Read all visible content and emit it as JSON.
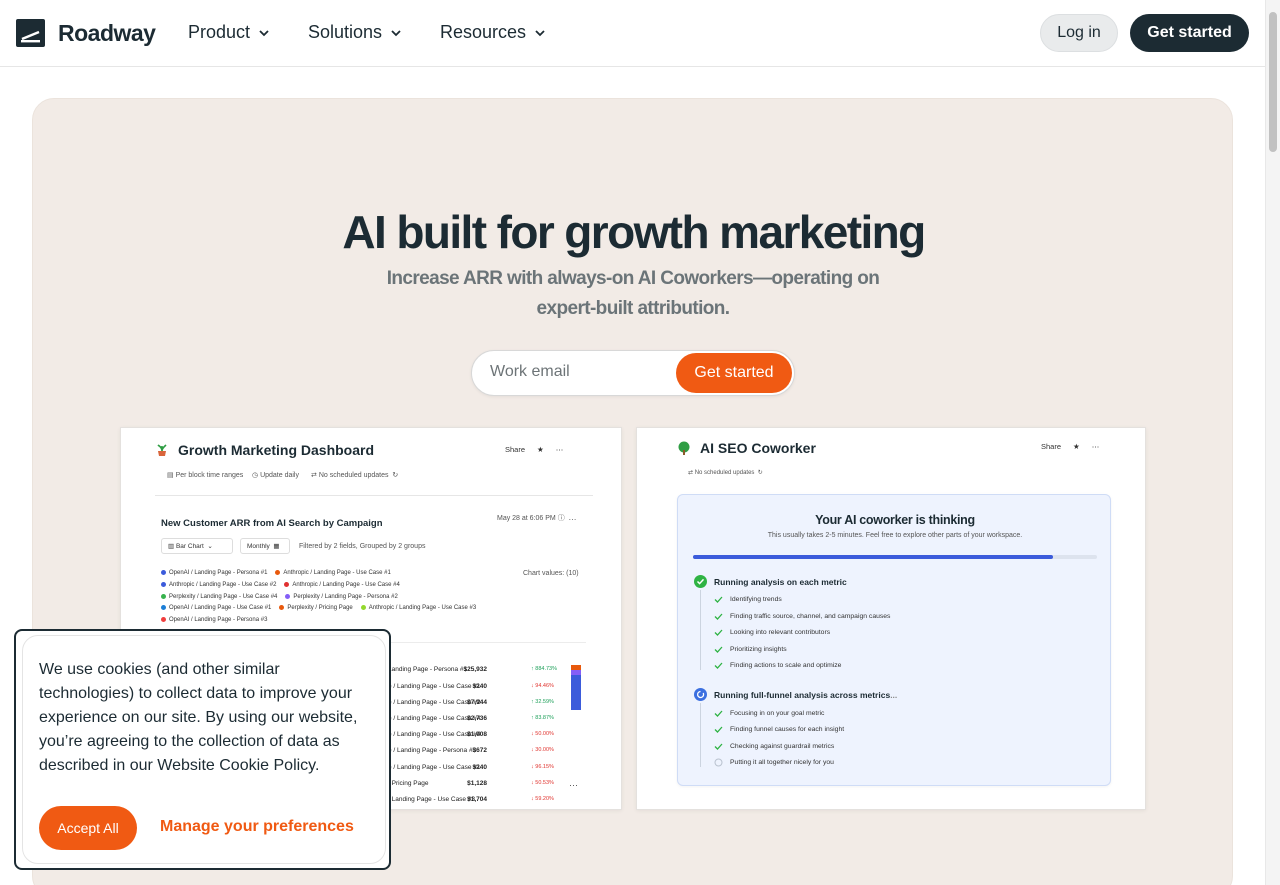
{
  "brand": {
    "name": "Roadway"
  },
  "nav": {
    "items": [
      {
        "label": "Product"
      },
      {
        "label": "Solutions"
      },
      {
        "label": "Resources"
      }
    ],
    "login": "Log in",
    "get_started": "Get started"
  },
  "hero": {
    "title": "AI built for growth marketing",
    "subtitle": "Increase ARR with always-on AI Coworkers—operating on expert-built attribution.",
    "email_placeholder": "Work email",
    "cta": "Get started"
  },
  "dashboard": {
    "title": "Growth Marketing Dashboard",
    "share": "Share",
    "meta": [
      "Per block time ranges",
      "Update daily",
      "No scheduled updates"
    ],
    "chart_title": "New Customer ARR from AI Search by Campaign",
    "chart_date": "May 28 at 6:06 PM",
    "chart_type": "Bar Chart",
    "period": "Monthly",
    "filter": "Filtered by 2 fields, Grouped by 2 groups",
    "chart_values": "Chart values: (10)",
    "legend": [
      {
        "label": "OpenAI / Landing Page - Persona #1",
        "color": "#3b5bdb"
      },
      {
        "label": "Anthropic / Landing Page - Use Case #1",
        "color": "#e8590c"
      },
      {
        "label": "Anthropic / Landing Page - Use Case #2",
        "color": "#3b5bdb"
      },
      {
        "label": "Anthropic / Landing Page - Use Case #4",
        "color": "#e03131"
      },
      {
        "label": "Perplexity / Landing Page - Use Case #4",
        "color": "#37b24d"
      },
      {
        "label": "Perplexity / Landing Page - Persona #2",
        "color": "#845ef7"
      },
      {
        "label": "OpenAI / Landing Page - Use Case #1",
        "color": "#1c7ed6"
      },
      {
        "label": "Perplexity / Pricing Page",
        "color": "#e8590c"
      },
      {
        "label": "Anthropic / Landing Page - Use Case #3",
        "color": "#94d82d"
      },
      {
        "label": "OpenAI / Landing Page - Persona #3",
        "color": "#f03e3e"
      }
    ],
    "table_header": "e",
    "rows": [
      {
        "name": "Landing Page - Persona #1",
        "value": "$25,932",
        "pct": "↑ 884.73%",
        "dir": "up"
      },
      {
        "name": "e / Landing Page - Use Case #1",
        "value": "$240",
        "pct": "↓ 94.46%",
        "dir": "down"
      },
      {
        "name": "e / Landing Page - Use Case #2",
        "value": "$7,944",
        "pct": "↑ 32.59%",
        "dir": "up"
      },
      {
        "name": "e / Landing Page - Use Case #4",
        "value": "$2,736",
        "pct": "↑ 83.87%",
        "dir": "up"
      },
      {
        "name": "e / Landing Page - Use Case #4",
        "value": "$1,008",
        "pct": "↓ 50.00%",
        "dir": "down"
      },
      {
        "name": "e / Landing Page - Persona #2",
        "value": "$672",
        "pct": "↓ 30.00%",
        "dir": "down"
      },
      {
        "name": "e / Landing Page - Use Case #1",
        "value": "$240",
        "pct": "↓ 96.15%",
        "dir": "down"
      },
      {
        "name": "/ Pricing Page",
        "value": "$1,128",
        "pct": "↓ 50.53%",
        "dir": "down"
      },
      {
        "name": "/ Landing Page - Use Case #3",
        "value": "$1,704",
        "pct": "↓ 59.20%",
        "dir": "down"
      }
    ]
  },
  "seo": {
    "title": "AI SEO Coworker",
    "share": "Share",
    "meta": "No scheduled updates",
    "thinking_title": "Your AI coworker is thinking",
    "thinking_sub": "This usually takes 2-5 minutes. Feel free to explore other parts of your workspace.",
    "progress": 0.89,
    "step1": {
      "label": "Running analysis on each metric",
      "items": [
        "Identifying trends",
        "Finding traffic source, channel, and campaign causes",
        "Looking into relevant contributors",
        "Prioritizing insights",
        "Finding actions to scale and optimize"
      ]
    },
    "step2": {
      "label": "Running full-funnel analysis across metrics",
      "items": [
        "Focusing in on your goal metric",
        "Finding funnel causes for each insight",
        "Checking against guardrail metrics"
      ],
      "pending": "Putting it all together nicely for you"
    }
  },
  "cookie": {
    "text": "We use cookies (and other similar technologies) to collect data to improve your experience on our site. By using our website, you’re agreeing to the collection of data as described in our Website Cookie Policy.",
    "accept": "Accept All",
    "manage": "Manage your preferences"
  }
}
